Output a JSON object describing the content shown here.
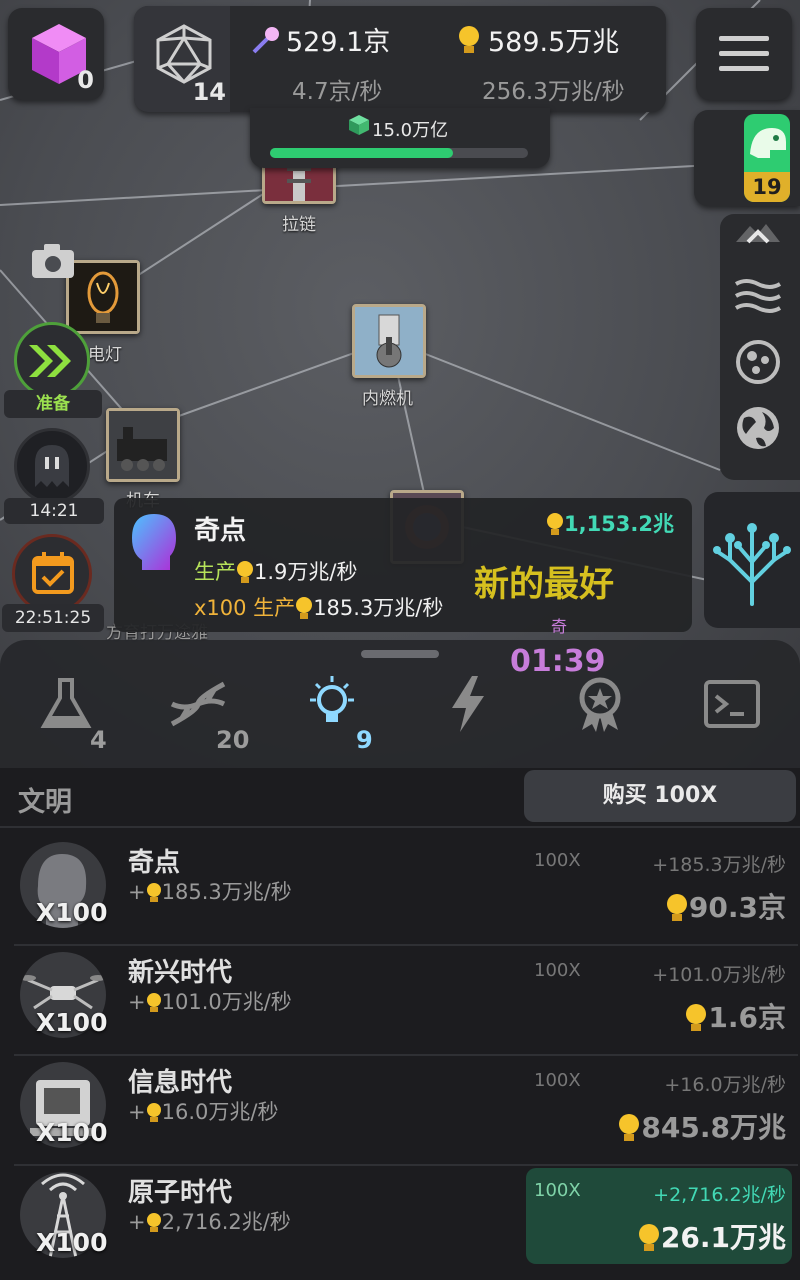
{
  "top": {
    "gems": "0",
    "level": "14",
    "resource1_value": "529.1京",
    "resource1_rate": "4.7京/秒",
    "resource2_value": "589.5万兆",
    "resource2_rate": "256.3万兆/秒",
    "progress_value": "15.0万亿",
    "progress_fraction": 0.71,
    "creature_count": "19"
  },
  "map": {
    "nodes": [
      {
        "label": "拉链"
      },
      {
        "label": "电灯"
      },
      {
        "label": "内燃机"
      },
      {
        "label": "机车"
      },
      {
        "label": "方育打万途雅"
      }
    ]
  },
  "left": {
    "boost_label": "准备",
    "timer1": "14:21",
    "timer2": "22:51:25"
  },
  "info": {
    "title": "奇点",
    "cost": "1,153.2兆",
    "prod_label": "生产",
    "prod_value": "1.9万兆/秒",
    "mult_label": "x100 生产",
    "mult_value": "185.3万兆/秒",
    "banner": "新的最好",
    "small_tag": "奇",
    "countdown": "01:39"
  },
  "tabs": [
    {
      "name": "lab",
      "count": "4"
    },
    {
      "name": "dna",
      "count": "20"
    },
    {
      "name": "ideas",
      "count": "9"
    },
    {
      "name": "energy",
      "count": ""
    },
    {
      "name": "awards",
      "count": ""
    },
    {
      "name": "console",
      "count": ""
    }
  ],
  "list": {
    "header": "文明",
    "buy_label": "购买 100X",
    "rows": [
      {
        "name": "奇点",
        "mult": "X100",
        "prod": "185.3万兆/秒",
        "buyx": "100X",
        "gain": "+185.3万兆/秒",
        "cost": "90.3京",
        "affordable": false
      },
      {
        "name": "新兴时代",
        "mult": "X100",
        "prod": "101.0万兆/秒",
        "buyx": "100X",
        "gain": "+101.0万兆/秒",
        "cost": "1.6京",
        "affordable": false
      },
      {
        "name": "信息时代",
        "mult": "X100",
        "prod": "16.0万兆/秒",
        "buyx": "100X",
        "gain": "+16.0万兆/秒",
        "cost": "845.8万兆",
        "affordable": false
      },
      {
        "name": "原子时代",
        "mult": "X100",
        "prod": "2,716.2兆/秒",
        "buyx": "100X",
        "gain": "+2,716.2兆/秒",
        "cost": "26.1万兆",
        "affordable": true
      }
    ]
  },
  "colors": {
    "accent_green": "#2ecc71",
    "banner_yellow": "#d6c01f",
    "countdown_purple": "#c77dda",
    "affordable_bg": "#1f4a3a",
    "cost_teal": "#42d9b5"
  }
}
